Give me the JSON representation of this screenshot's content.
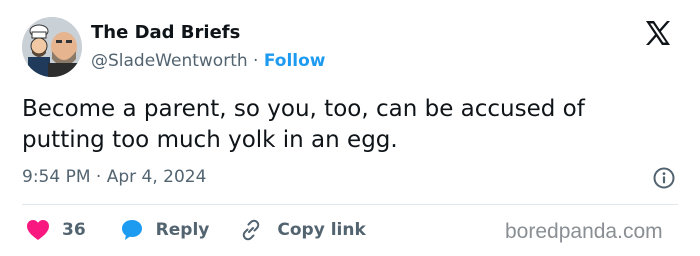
{
  "tweet": {
    "author_name": "The Dad Briefs",
    "handle": "@SladeWentworth",
    "separator": "·",
    "follow_label": "Follow",
    "text": "Become a parent, so you, too, can be accused of putting too much yolk in an egg.",
    "time": "9:54 PM",
    "date": "Apr 4, 2024"
  },
  "actions": {
    "like_count": "36",
    "reply_label": "Reply",
    "copy_link_label": "Copy link"
  },
  "icons": {
    "platform": "x-logo-icon",
    "info": "info-icon",
    "like": "heart-icon",
    "reply": "speech-bubble-icon",
    "copy": "link-icon"
  },
  "colors": {
    "accent": "#1d9bf0",
    "heart": "#f91880",
    "text": "#0f1419",
    "muted": "#536471"
  },
  "watermark": "boredpanda.com"
}
